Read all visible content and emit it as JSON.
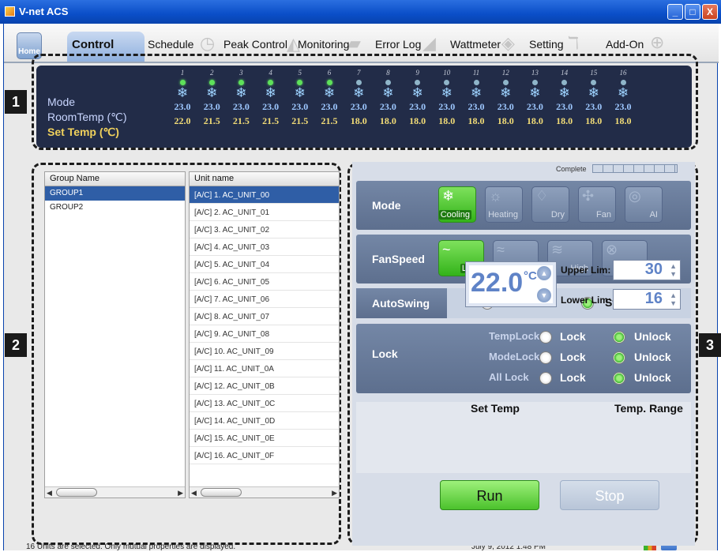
{
  "window": {
    "title": "V-net ACS",
    "buttons": [
      "_",
      "□",
      "X"
    ]
  },
  "tabs": {
    "home": "Home",
    "items": [
      "Control",
      "Schedule",
      "Peak Control",
      "Monitoring",
      "Error Log",
      "Wattmeter",
      "Setting",
      "Add-On"
    ],
    "active": "Control"
  },
  "markers": [
    "1",
    "2",
    "3"
  ],
  "overview": {
    "labels": {
      "mode": "Mode",
      "room": "RoomTemp (℃)",
      "set": "Set Temp  (℃)"
    },
    "units": [
      {
        "n": "1",
        "on": true,
        "room": "23.0",
        "set": "22.0"
      },
      {
        "n": "2",
        "on": true,
        "room": "23.0",
        "set": "21.5"
      },
      {
        "n": "3",
        "on": true,
        "room": "23.0",
        "set": "21.5"
      },
      {
        "n": "4",
        "on": true,
        "room": "23.0",
        "set": "21.5"
      },
      {
        "n": "5",
        "on": true,
        "room": "23.0",
        "set": "21.5"
      },
      {
        "n": "6",
        "on": true,
        "room": "23.0",
        "set": "21.5"
      },
      {
        "n": "7",
        "on": false,
        "room": "23.0",
        "set": "18.0"
      },
      {
        "n": "8",
        "on": false,
        "room": "23.0",
        "set": "18.0"
      },
      {
        "n": "9",
        "on": false,
        "room": "23.0",
        "set": "18.0"
      },
      {
        "n": "10",
        "on": false,
        "room": "23.0",
        "set": "18.0"
      },
      {
        "n": "11",
        "on": false,
        "room": "23.0",
        "set": "18.0"
      },
      {
        "n": "12",
        "on": false,
        "room": "23.0",
        "set": "18.0"
      },
      {
        "n": "13",
        "on": false,
        "room": "23.0",
        "set": "18.0"
      },
      {
        "n": "14",
        "on": false,
        "room": "23.0",
        "set": "18.0"
      },
      {
        "n": "15",
        "on": false,
        "room": "23.0",
        "set": "18.0"
      },
      {
        "n": "16",
        "on": false,
        "room": "23.0",
        "set": "18.0"
      }
    ],
    "colors": {
      "panel": "#222c48",
      "led_on": "#5ee15a",
      "set_temp": "#f2dc77"
    }
  },
  "groups": {
    "header": "Group Name",
    "items": [
      "GROUP1",
      "GROUP2"
    ],
    "selected_index": 0
  },
  "units": {
    "header": "Unit name",
    "items": [
      "[A/C] 1. AC_UNIT_00",
      "[A/C] 2. AC_UNIT_01",
      "[A/C] 3. AC_UNIT_02",
      "[A/C] 4. AC_UNIT_03",
      "[A/C] 5. AC_UNIT_04",
      "[A/C] 6. AC_UNIT_05",
      "[A/C] 7. AC_UNIT_06",
      "[A/C] 8. AC_UNIT_07",
      "[A/C] 9. AC_UNIT_08",
      "[A/C] 10. AC_UNIT_09",
      "[A/C] 11. AC_UNIT_0A",
      "[A/C] 12. AC_UNIT_0B",
      "[A/C] 13. AC_UNIT_0C",
      "[A/C] 14. AC_UNIT_0D",
      "[A/C] 15. AC_UNIT_0E",
      "[A/C] 16. AC_UNIT_0F"
    ],
    "selected_index": 0
  },
  "control": {
    "complete_label": "Complete",
    "mode": {
      "label": "Mode",
      "options": [
        "Cooling",
        "Heating",
        "Dry",
        "Fan",
        "AI"
      ],
      "selected": "Cooling",
      "icons": [
        "snowflake-icon",
        "sun-icon",
        "droplet-icon",
        "fan-icon",
        "ai-icon"
      ]
    },
    "fanspeed": {
      "label": "FanSpeed",
      "options": [
        "Low",
        "Medium",
        "High",
        "Auto"
      ],
      "selected": "Low",
      "icons": [
        "wave-low-icon",
        "wave-medium-icon",
        "wave-high-icon",
        "fan-auto-icon"
      ]
    },
    "autoswing": {
      "label": "AutoSwing",
      "run": "Run",
      "stop": "Stop",
      "selected": "Stop"
    },
    "lock": {
      "label": "Lock",
      "lock": "Lock",
      "unlock": "Unlock",
      "items": [
        {
          "name": "TempLock",
          "selected": "Unlock"
        },
        {
          "name": "ModeLock",
          "selected": "Unlock"
        },
        {
          "name": "All Lock",
          "selected": "Unlock"
        }
      ]
    },
    "set_temp": {
      "label": "Set Temp",
      "value": "22.0",
      "unit": "°C"
    },
    "temp_range": {
      "label": "Temp. Range",
      "upper_label": "Upper Lim:",
      "upper": "30",
      "lower_label": "Lower Lim:",
      "lower": "16"
    },
    "run_label": "Run",
    "stop_label": "Stop",
    "colors": {
      "active_green": "#4bc22c",
      "row_blue": "#5d6f8e"
    }
  },
  "status": {
    "message": "16 Units are selected. Only mutual properties are displayed.",
    "datetime": "July 9, 2012  1:48 PM"
  }
}
